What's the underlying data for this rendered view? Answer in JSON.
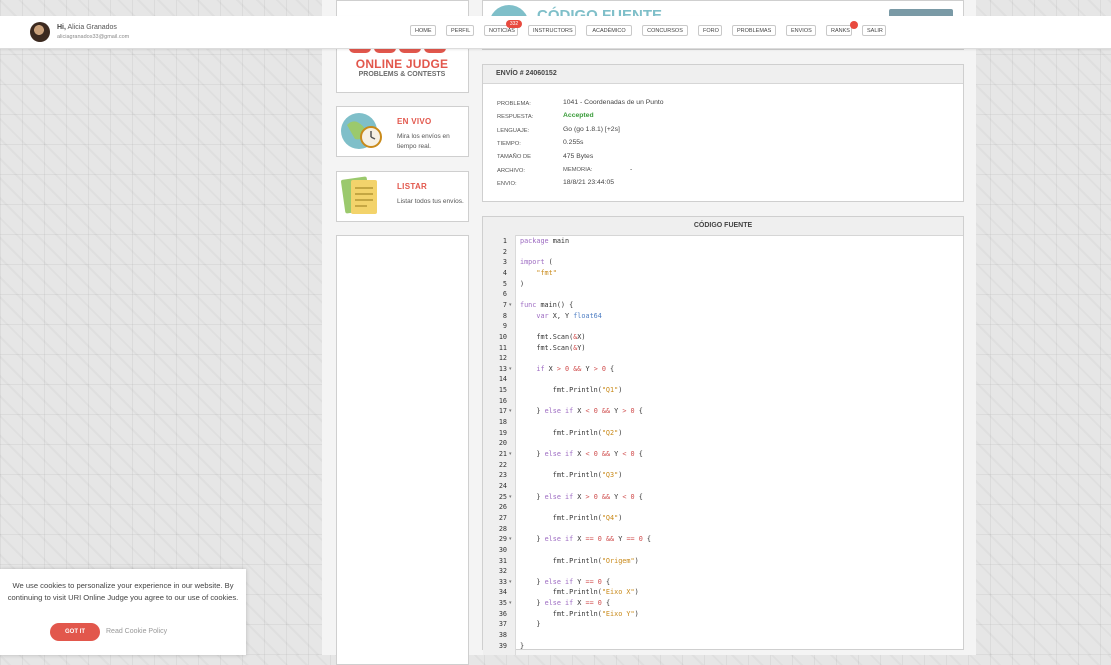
{
  "user": {
    "greeting": "Hi,",
    "name": "Alicia Granados",
    "email": "aliciagranados33@gmail.com"
  },
  "nav": [
    {
      "label": "HOME"
    },
    {
      "label": "PERFIL"
    },
    {
      "label": "NOTICIAS",
      "badge": "332"
    },
    {
      "label": "INSTRUCTORS"
    },
    {
      "label": "ACADÉMICO"
    },
    {
      "label": "CONCURSOS"
    },
    {
      "label": "FORO"
    },
    {
      "label": "PROBLEMAS"
    },
    {
      "label": "ENVIOS"
    },
    {
      "label": "RANKS",
      "dot": true
    },
    {
      "label": "SALIR"
    }
  ],
  "header_peek": "CÓDIGO FUENTE",
  "logo": {
    "title": "ONLINE JUDGE",
    "subtitle": "PROBLEMS & CONTESTS"
  },
  "features": [
    {
      "icon": "globe-clock-icon",
      "title": "EN VIVO",
      "desc": "Mira los envíos en tiempo real."
    },
    {
      "icon": "documents-icon",
      "title": "LISTAR",
      "desc": "Listar todos tus envíos."
    }
  ],
  "submission": {
    "title": "ENVÍO # 24060152",
    "rows": [
      {
        "label": "PROBLEMA:",
        "value": "1041 - Coordenadas de un Punto"
      },
      {
        "label": "RESPUESTA:",
        "value": "Accepted"
      },
      {
        "label": "LENGUAJE:",
        "value": "Go (go 1.8.1) [+2s]"
      },
      {
        "label": "TIEMPO:",
        "value": "0.255s"
      },
      {
        "label": "TAMAÑO DE",
        "value": "475 Bytes"
      },
      {
        "label": "ARCHIVO:",
        "value": "MEMORIA:",
        "extra": "-"
      },
      {
        "label": "ENVIO:",
        "value": "18/8/21 23:44:05"
      }
    ]
  },
  "source": {
    "title": "CÓDIGO FUENTE",
    "lines": [
      "package main",
      "",
      "import (",
      "    \"fmt\"",
      ")",
      "",
      "func main() {",
      "    var X, Y float64",
      "",
      "    fmt.Scan(&X)",
      "    fmt.Scan(&Y)",
      "",
      "    if X > 0 && Y > 0 {",
      "",
      "        fmt.Println(\"Q1\")",
      "",
      "    } else if X < 0 && Y > 0 {",
      "",
      "        fmt.Println(\"Q2\")",
      "",
      "    } else if X < 0 && Y < 0 {",
      "",
      "        fmt.Println(\"Q3\")",
      "",
      "    } else if X > 0 && Y < 0 {",
      "",
      "        fmt.Println(\"Q4\")",
      "",
      "    } else if X == 0 && Y == 0 {",
      "",
      "        fmt.Println(\"Origem\")",
      "",
      "    } else if Y == 0 {",
      "        fmt.Println(\"Eixo X\")",
      "    } else if X == 0 {",
      "        fmt.Println(\"Eixo Y\")",
      "    }",
      "",
      "}"
    ],
    "fold_lines": [
      7,
      13,
      17,
      21,
      25,
      29,
      33,
      35
    ]
  },
  "cookie": {
    "text": "We use cookies to personalize your experience in our website. By continuing to visit URI Online Judge you agree to our use of cookies.",
    "button": "GOT IT",
    "link": "Read Cookie Policy"
  }
}
